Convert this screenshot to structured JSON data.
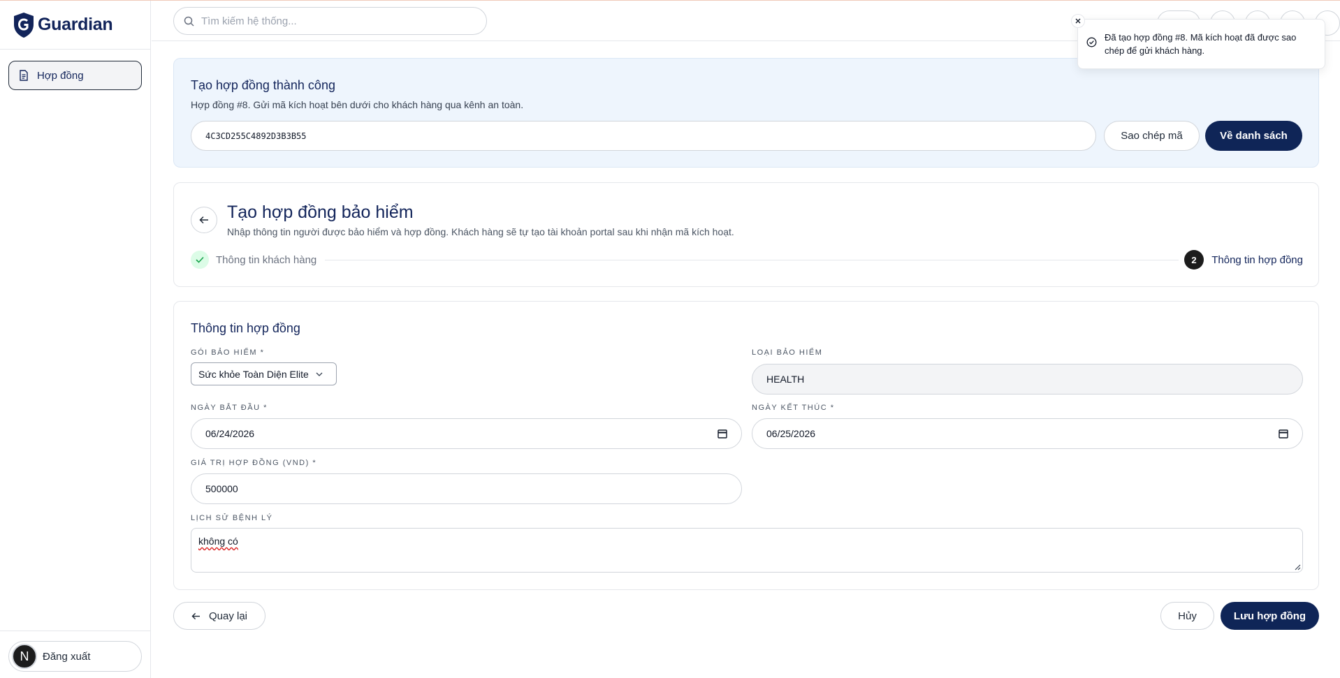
{
  "app": {
    "brand": "Guardian"
  },
  "sidebar": {
    "items": [
      {
        "label": "Hợp đồng",
        "icon": "document-icon"
      }
    ],
    "logout_label": "Đăng xuất",
    "avatar_letter": "N"
  },
  "topbar": {
    "search_placeholder": "Tìm kiếm hệ thống..."
  },
  "toast": {
    "message": "Đã tạo hợp đồng #8. Mã kích hoạt đã được sao chép để gửi khách hàng."
  },
  "success": {
    "title": "Tạo hợp đồng thành công",
    "description": "Hợp đồng #8. Gửi mã kích hoạt bên dưới cho khách hàng qua kênh an toàn.",
    "activation_code": "4C3CD255C4892D3B3B55",
    "copy_label": "Sao chép mã",
    "back_to_list_label": "Về danh sách"
  },
  "header": {
    "title": "Tạo hợp đồng bảo hiểm",
    "subtitle": "Nhập thông tin người được bảo hiểm và hợp đồng. Khách hàng sẽ tự tạo tài khoản portal sau khi nhận mã kích hoạt.",
    "steps": [
      {
        "label": "Thông tin khách hàng",
        "status": "done"
      },
      {
        "number": "2",
        "label": "Thông tin hợp đồng",
        "status": "active"
      }
    ]
  },
  "form": {
    "title": "Thông tin hợp đồng",
    "package": {
      "label": "GÓI BẢO HIỂM *",
      "value": "Sức khỏe Toàn Diện Elite"
    },
    "insurance_type": {
      "label": "LOẠI BẢO HIỂM",
      "value": "HEALTH"
    },
    "start_date": {
      "label": "NGÀY BẮT ĐẦU *",
      "value": "06/24/2026"
    },
    "end_date": {
      "label": "NGÀY KẾT THÚC *",
      "value": "06/25/2026"
    },
    "contract_value": {
      "label": "GIÁ TRỊ HỢP ĐỒNG (VND) *",
      "value": "500000"
    },
    "medical_history": {
      "label": "LỊCH SỬ BỆNH LÝ",
      "value": "không có"
    }
  },
  "actions": {
    "back_label": "Quay lại",
    "cancel_label": "Hủy",
    "save_label": "Lưu hợp đồng"
  },
  "colors": {
    "primary": "#0f2557",
    "accent_text": "#12245a",
    "success_bg": "#eef5fd"
  }
}
